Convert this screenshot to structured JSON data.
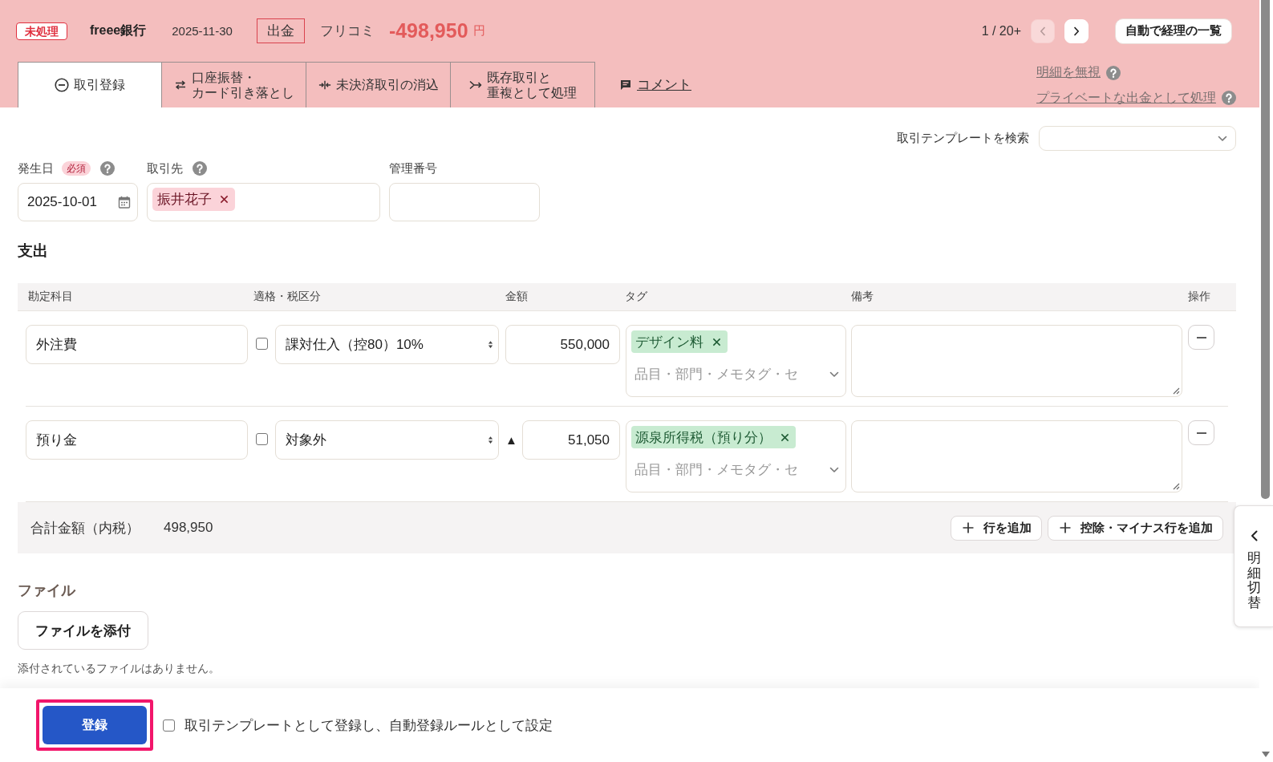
{
  "header": {
    "status_badge": "未処理",
    "account_name": "freee銀行",
    "date": "2025-11-30",
    "direction": "出金",
    "description": "フリコミ",
    "amount": "-498,950",
    "currency": "円",
    "pager": {
      "position": "1 / 20+",
      "prev_disabled": true,
      "next_disabled": false
    },
    "list_button": "自動で経理の一覧"
  },
  "tabs": [
    {
      "label_lines": [
        "取引登録"
      ],
      "kind": "register",
      "selected": true
    },
    {
      "label_lines": [
        "口座振替・",
        "カード引き落とし"
      ],
      "kind": "transfer",
      "selected": false
    },
    {
      "label_lines": [
        "未決済取引の消込"
      ],
      "kind": "settle",
      "selected": false
    },
    {
      "label_lines": [
        "既存取引と",
        "重複として処理"
      ],
      "kind": "duplicate",
      "selected": false
    }
  ],
  "comment_link": "コメント",
  "side_links": [
    {
      "label": "明細を無視",
      "help": true
    },
    {
      "label": "プライベートな出金として処理",
      "help": true
    }
  ],
  "template_search": {
    "label": "取引テンプレートを検索"
  },
  "fields": {
    "date": {
      "label": "発生日",
      "required_badge": "必須",
      "help": true,
      "value": "2025-10-01"
    },
    "partner": {
      "label": "取引先",
      "help": true,
      "tags": [
        "振井花子"
      ]
    },
    "management_number": {
      "label": "管理番号"
    }
  },
  "expense": {
    "title": "支出",
    "columns": [
      "勘定科目",
      "適格・税区分",
      "金額",
      "タグ",
      "備考",
      "操作"
    ],
    "rows": [
      {
        "account": "外注費",
        "qualified": false,
        "tax": "課対仕入（控80）10%",
        "amount": "550,000",
        "tags": [
          "デザイン料"
        ],
        "tag_placeholder": "品目・部門・メモタグ・セ"
      },
      {
        "account": "預り金",
        "qualified": false,
        "tax": "対象外",
        "sign": "▲",
        "amount": "51,050",
        "tags": [
          "源泉所得税（預り分）"
        ],
        "tag_placeholder": "品目・部門・メモタグ・セ"
      }
    ],
    "total": {
      "label": "合計金額（内税）",
      "value": "498,950"
    },
    "add_buttons": [
      "行を追加",
      "控除・マイナス行を追加"
    ]
  },
  "file": {
    "title": "ファイル",
    "attach_button": "ファイルを添付",
    "empty_text": "添付されているファイルはありません。"
  },
  "footer": {
    "submit_button": "登録",
    "highlighted": true,
    "template_checkbox": {
      "label": "取引テンプレートとして登録し、自動登録ルールとして設定",
      "checked": false
    }
  },
  "side_tab": {
    "label": "明細切替"
  }
}
